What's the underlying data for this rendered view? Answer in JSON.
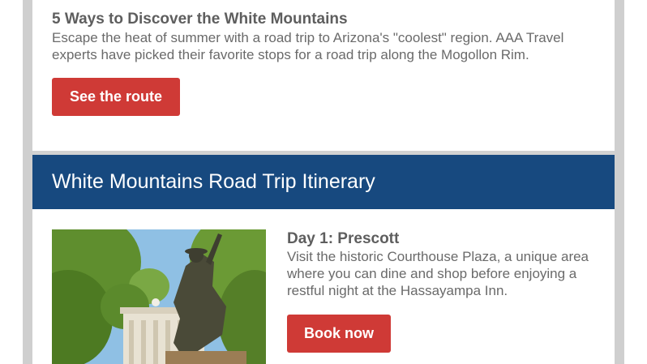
{
  "feature": {
    "headline": "5 Ways to Discover the White Mountains",
    "description": "Escape the heat of summer with a road trip to Arizona's \"coolest\" region. AAA Travel experts have picked their favorite stops for a road trip along the Mogollon Rim.",
    "button_label": "See the route"
  },
  "itinerary": {
    "title": "White Mountains Road Trip Itinerary",
    "days": [
      {
        "title": "Day 1: Prescott",
        "description": "Visit the historic Courthouse Plaza, a unique area where you can dine and shop before enjoying a restful night at the Hassayampa Inn.",
        "button_label": "Book now"
      }
    ]
  },
  "colors": {
    "banner": "#17497f",
    "button": "#cf3a36",
    "rail": "#cfcfcf"
  }
}
